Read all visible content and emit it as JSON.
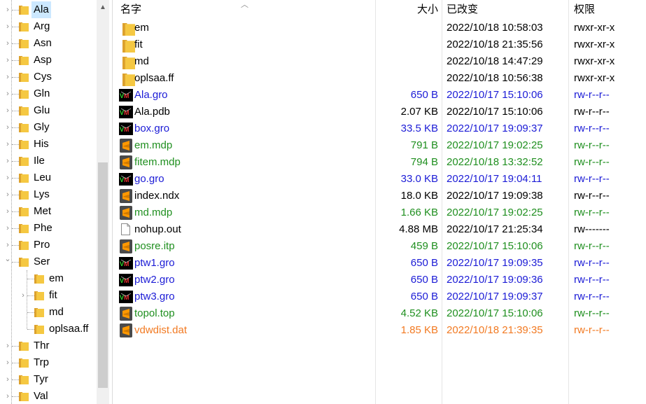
{
  "tree": {
    "items": [
      {
        "label": "Ala",
        "selected": true
      },
      {
        "label": "Arg"
      },
      {
        "label": "Asn"
      },
      {
        "label": "Asp"
      },
      {
        "label": "Cys"
      },
      {
        "label": "Gln"
      },
      {
        "label": "Glu"
      },
      {
        "label": "Gly"
      },
      {
        "label": "His"
      },
      {
        "label": "Ile"
      },
      {
        "label": "Leu"
      },
      {
        "label": "Lys"
      },
      {
        "label": "Met"
      },
      {
        "label": "Phe"
      },
      {
        "label": "Pro"
      },
      {
        "label": "Ser",
        "expanded": true
      },
      {
        "label": "em",
        "child": true
      },
      {
        "label": "fit",
        "child": true,
        "hasChildren": true
      },
      {
        "label": "md",
        "child": true
      },
      {
        "label": "oplsaa.ff",
        "child": true
      },
      {
        "label": "Thr"
      },
      {
        "label": "Trp"
      },
      {
        "label": "Tyr"
      },
      {
        "label": "Val"
      }
    ]
  },
  "list": {
    "headers": {
      "name": "名字",
      "size": "大小",
      "date": "已改变",
      "perm": "权限"
    },
    "rows": [
      {
        "name": "em",
        "size": "",
        "date": "2022/10/18 10:58:03",
        "perm": "rwxr-xr-x",
        "icon": "folder",
        "color": "black"
      },
      {
        "name": "fit",
        "size": "",
        "date": "2022/10/18 21:35:56",
        "perm": "rwxr-xr-x",
        "icon": "folder",
        "color": "black"
      },
      {
        "name": "md",
        "size": "",
        "date": "2022/10/18 14:47:29",
        "perm": "rwxr-xr-x",
        "icon": "folder",
        "color": "black"
      },
      {
        "name": "oplsaa.ff",
        "size": "",
        "date": "2022/10/18 10:56:38",
        "perm": "rwxr-xr-x",
        "icon": "folder",
        "color": "black"
      },
      {
        "name": "Ala.gro",
        "size": "650 B",
        "date": "2022/10/17 15:10:06",
        "perm": "rw-r--r--",
        "icon": "vmd",
        "color": "blue"
      },
      {
        "name": "Ala.pdb",
        "size": "2.07 KB",
        "date": "2022/10/17 15:10:06",
        "perm": "rw-r--r--",
        "icon": "vmd",
        "color": "black"
      },
      {
        "name": "box.gro",
        "size": "33.5 KB",
        "date": "2022/10/17 19:09:37",
        "perm": "rw-r--r--",
        "icon": "vmd",
        "color": "blue"
      },
      {
        "name": "em.mdp",
        "size": "791 B",
        "date": "2022/10/17 19:02:25",
        "perm": "rw-r--r--",
        "icon": "sublime",
        "color": "green"
      },
      {
        "name": "fitem.mdp",
        "size": "794 B",
        "date": "2022/10/18 13:32:52",
        "perm": "rw-r--r--",
        "icon": "sublime",
        "color": "green"
      },
      {
        "name": "go.gro",
        "size": "33.0 KB",
        "date": "2022/10/17 19:04:11",
        "perm": "rw-r--r--",
        "icon": "vmd",
        "color": "blue"
      },
      {
        "name": "index.ndx",
        "size": "18.0 KB",
        "date": "2022/10/17 19:09:38",
        "perm": "rw-r--r--",
        "icon": "sublime",
        "color": "black"
      },
      {
        "name": "md.mdp",
        "size": "1.66 KB",
        "date": "2022/10/17 19:02:25",
        "perm": "rw-r--r--",
        "icon": "sublime",
        "color": "green"
      },
      {
        "name": "nohup.out",
        "size": "4.88 MB",
        "date": "2022/10/17 21:25:34",
        "perm": "rw-------",
        "icon": "file",
        "color": "black"
      },
      {
        "name": "posre.itp",
        "size": "459 B",
        "date": "2022/10/17 15:10:06",
        "perm": "rw-r--r--",
        "icon": "sublime",
        "color": "green"
      },
      {
        "name": "ptw1.gro",
        "size": "650 B",
        "date": "2022/10/17 19:09:35",
        "perm": "rw-r--r--",
        "icon": "vmd",
        "color": "blue"
      },
      {
        "name": "ptw2.gro",
        "size": "650 B",
        "date": "2022/10/17 19:09:36",
        "perm": "rw-r--r--",
        "icon": "vmd",
        "color": "blue"
      },
      {
        "name": "ptw3.gro",
        "size": "650 B",
        "date": "2022/10/17 19:09:37",
        "perm": "rw-r--r--",
        "icon": "vmd",
        "color": "blue"
      },
      {
        "name": "topol.top",
        "size": "4.52 KB",
        "date": "2022/10/17 15:10:06",
        "perm": "rw-r--r--",
        "icon": "sublime",
        "color": "green"
      },
      {
        "name": "vdwdist.dat",
        "size": "1.85 KB",
        "date": "2022/10/18 21:39:35",
        "perm": "rw-r--r--",
        "icon": "sublime",
        "color": "orange"
      }
    ]
  },
  "colors": {
    "blue": "#1b1bd6",
    "green": "#1f8f1f",
    "orange": "#f27a22",
    "selection": "#cce8ff",
    "folder": "#f5c842"
  }
}
